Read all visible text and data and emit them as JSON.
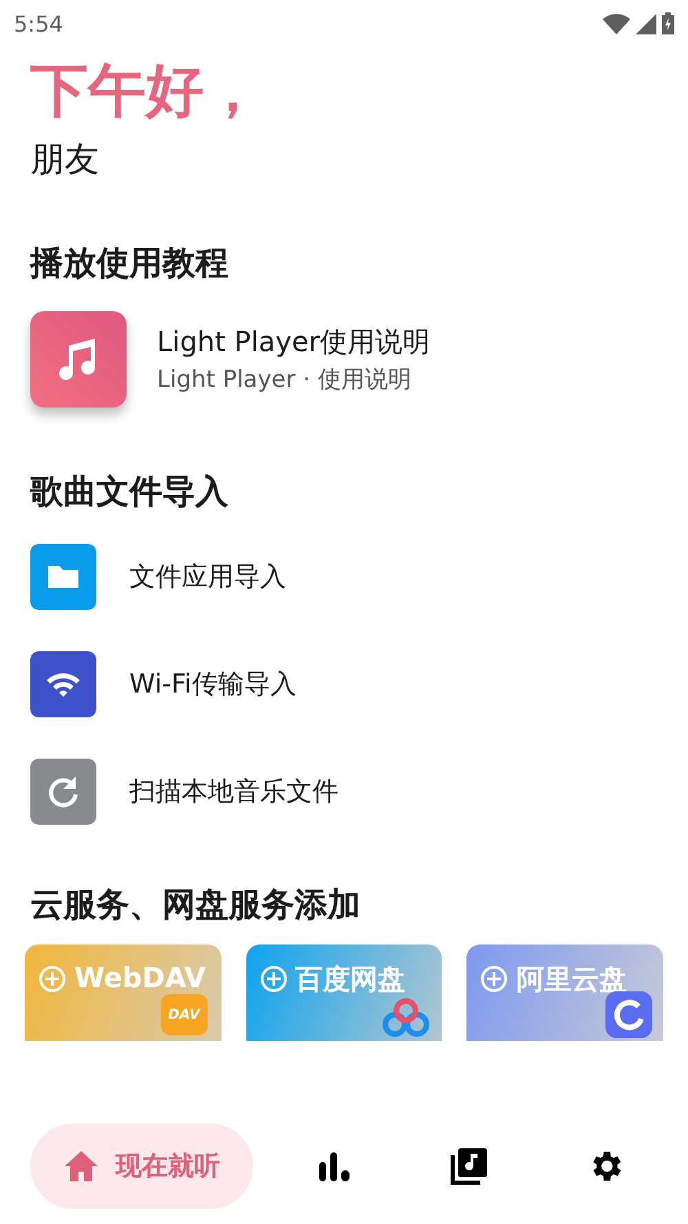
{
  "status_bar": {
    "time": "5:54"
  },
  "greeting": {
    "title": "下午好，",
    "subtitle": "朋友"
  },
  "tutorial": {
    "title": "播放使用教程",
    "items": [
      {
        "title": "Light Player使用说明",
        "subtitle": "Light Player · 使用说明"
      }
    ]
  },
  "import": {
    "title": "歌曲文件导入",
    "items": [
      {
        "kind": "folder",
        "label": "文件应用导入"
      },
      {
        "kind": "wifi",
        "label": "Wi-Fi传输导入"
      },
      {
        "kind": "scan",
        "label": "扫描本地音乐文件"
      }
    ]
  },
  "cloud": {
    "title": "云服务、网盘服务添加",
    "cards": [
      {
        "kind": "webdav",
        "label": "WebDAV",
        "logo_text": "DAV"
      },
      {
        "kind": "baidu",
        "label": "百度网盘"
      },
      {
        "kind": "aliyun",
        "label": "阿里云盘"
      }
    ]
  },
  "nav": [
    {
      "kind": "home",
      "label": "现在就听",
      "selected": true
    },
    {
      "kind": "stats",
      "selected": false
    },
    {
      "kind": "library",
      "selected": false
    },
    {
      "kind": "settings",
      "selected": false
    }
  ]
}
